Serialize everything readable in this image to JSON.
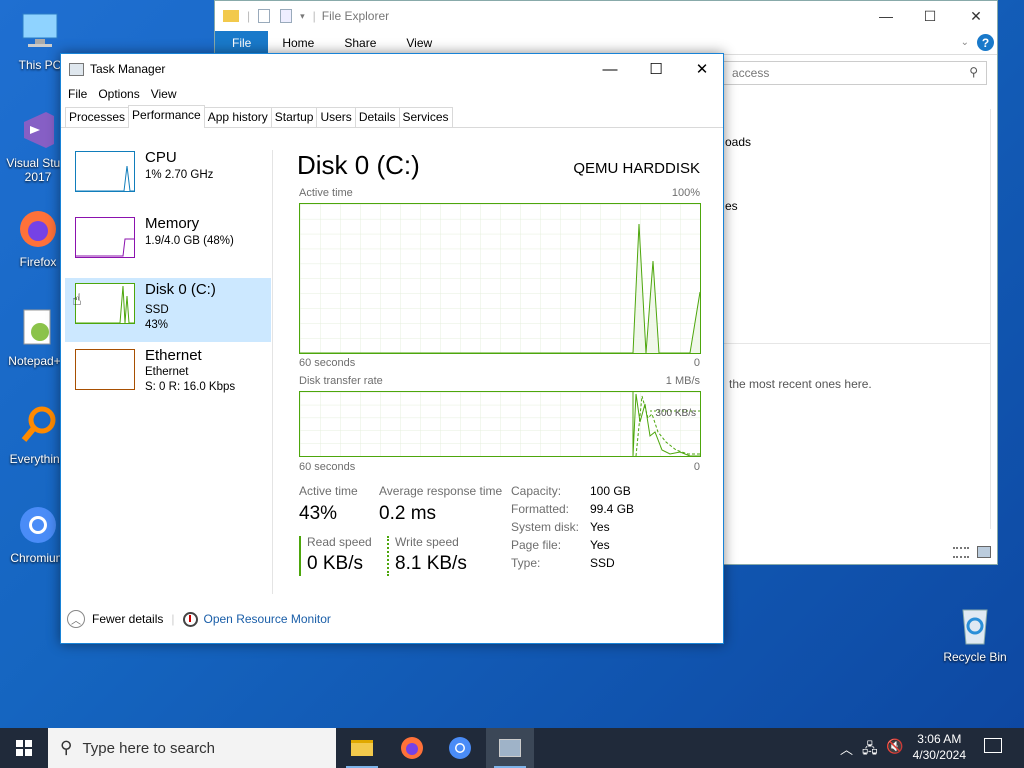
{
  "desktop": {
    "icons": [
      {
        "label": "This PC"
      },
      {
        "label": "Visual Studio 2017",
        "line1": "Visual Studi",
        "line2": "2017"
      },
      {
        "label": "Firefox"
      },
      {
        "label": "Notepad++"
      },
      {
        "label": "Everything"
      },
      {
        "label": "Chromium"
      },
      {
        "label": "Recycle Bin"
      }
    ]
  },
  "file_explorer": {
    "title": "File Explorer",
    "ribbon": [
      "File",
      "Home",
      "Share",
      "View"
    ],
    "search_placeholder": "access",
    "content": {
      "item1": "oads",
      "item2": "es",
      "recent_text": "the most recent ones here."
    }
  },
  "task_manager": {
    "title": "Task Manager",
    "menu": [
      "File",
      "Options",
      "View"
    ],
    "tabs": [
      "Processes",
      "Performance",
      "App history",
      "Startup",
      "Users",
      "Details",
      "Services"
    ],
    "active_tab": "Performance",
    "sidebar": [
      {
        "name": "CPU",
        "sub1": "1% 2.70 GHz",
        "sub2": "",
        "color": "#117dbb"
      },
      {
        "name": "Memory",
        "sub1": "1.9/4.0 GB (48%)",
        "sub2": "",
        "color": "#8b12ae"
      },
      {
        "name": "Disk 0 (C:)",
        "sub1": "SSD",
        "sub2": "43%",
        "color": "#4da60c"
      },
      {
        "name": "Ethernet",
        "sub1": "Ethernet",
        "sub2": "S: 0 R: 16.0 Kbps",
        "color": "#a74f01"
      }
    ],
    "detail": {
      "title": "Disk 0 (C:)",
      "model": "QEMU HARDDISK",
      "graph1": {
        "label": "Active time",
        "max": "100%",
        "time": "60 seconds",
        "min": "0"
      },
      "graph2": {
        "label": "Disk transfer rate",
        "max": "1 MB/s",
        "marker": "300 KB/s",
        "time": "60 seconds",
        "min": "0"
      },
      "stats": {
        "active_time_label": "Active time",
        "active_time_value": "43%",
        "avg_resp_label": "Average response time",
        "avg_resp_value": "0.2 ms",
        "read_label": "Read speed",
        "read_value": "0 KB/s",
        "write_label": "Write speed",
        "write_value": "8.1 KB/s"
      },
      "props": [
        {
          "k": "Capacity:",
          "v": "100 GB"
        },
        {
          "k": "Formatted:",
          "v": "99.4 GB"
        },
        {
          "k": "System disk:",
          "v": "Yes"
        },
        {
          "k": "Page file:",
          "v": "Yes"
        },
        {
          "k": "Type:",
          "v": "SSD"
        }
      ]
    },
    "footer": {
      "fewer": "Fewer details",
      "resource_monitor": "Open Resource Monitor"
    }
  },
  "taskbar": {
    "search_placeholder": "Type here to search",
    "time": "3:06 AM",
    "date": "4/30/2024"
  }
}
